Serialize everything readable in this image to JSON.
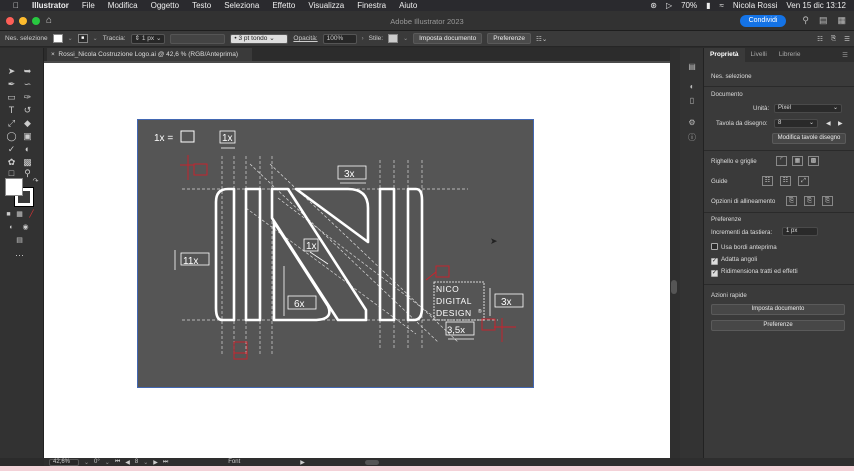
{
  "menubar": {
    "app": "Illustrator",
    "items": [
      "File",
      "Modifica",
      "Oggetto",
      "Testo",
      "Seleziona",
      "Effetto",
      "Visualizza",
      "Finestra",
      "Aiuto"
    ],
    "battery": "70%",
    "user": "Nicola Rossi",
    "datetime": "Ven 15 dic 13:12"
  },
  "window": {
    "title": "Adobe Illustrator 2023",
    "share_label": "Condividi"
  },
  "control": {
    "selection": "Nes. selezione",
    "stroke_label": "Traccia:",
    "stroke_value": "1 px",
    "brush": "3 pt tondo",
    "opacity_label": "Opacità:",
    "opacity_value": "100%",
    "style_label": "Stile:",
    "doc_setup": "Imposta documento",
    "preferences": "Preferenze"
  },
  "document": {
    "tab_label": "Rossi_Nicola Costruzione Logo.ai @ 42,6 % (RGB/Anteprima)"
  },
  "artwork": {
    "unit_legend": "1x =",
    "labels": {
      "one_x": "1x",
      "three_x": "3x",
      "eleven_x": "11x",
      "six_x": "6x",
      "three_five_x": "3,5x",
      "tag_line1": "NICO",
      "tag_line2": "DIGITAL",
      "tag_line3": "DESIGN",
      "registered": "®"
    },
    "colors": {
      "background": "#555555",
      "stroke": "#ffffff",
      "guide": "#dddddd",
      "accent": "#d0202a"
    }
  },
  "panel": {
    "tabs": [
      "Proprietà",
      "Livelli",
      "Librerie"
    ],
    "selection": "Nes. selezione",
    "document_header": "Documento",
    "units_label": "Unità:",
    "units_value": "Pixel",
    "artboard_label": "Tavola da disegno:",
    "artboard_value": "8",
    "edit_artboards": "Modifica tavole disegno",
    "rulers_grids": "Righello e griglie",
    "guides": "Guide",
    "align_options": "Opzioni di allineamento",
    "preferences_header": "Preferenze",
    "keyboard_increment_label": "Incrementi da tastiera:",
    "keyboard_increment_value": "1 px",
    "use_preview_bounds": "Usa bordi anteprima",
    "scale_corners": "Adatta angoli",
    "scale_strokes": "Ridimensiona tratti ed effetti",
    "quick_actions": "Azioni rapide",
    "doc_setup_btn": "Imposta documento",
    "preferences_btn": "Preferenze"
  },
  "status": {
    "zoom": "42,6%",
    "rotation": "0°",
    "artboard": "8",
    "tool": "Font"
  }
}
